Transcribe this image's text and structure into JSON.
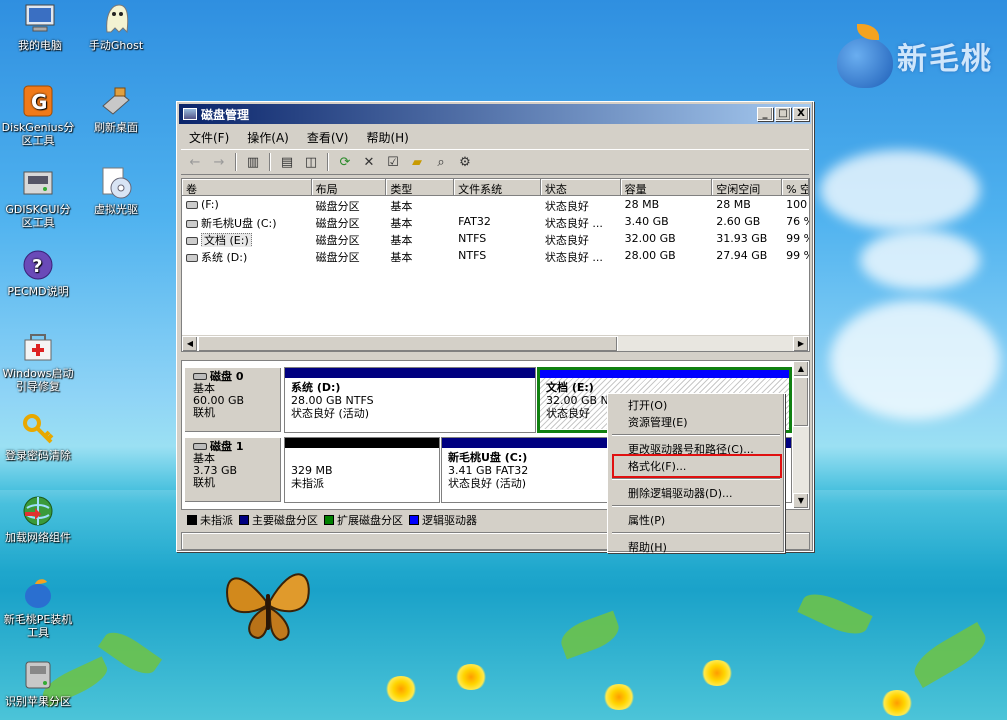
{
  "brand": {
    "name": "新毛桃"
  },
  "desktop_icons": [
    {
      "label": "我的电脑",
      "icon": "computer-icon"
    },
    {
      "label": "手动Ghost",
      "icon": "ghost-icon"
    },
    {
      "label": "DiskGenius分区工具",
      "icon": "diskgenius-icon"
    },
    {
      "label": "刷新桌面",
      "icon": "refresh-desktop-icon"
    },
    {
      "label": "GDISKGUI分区工具",
      "icon": "gdiskgui-icon"
    },
    {
      "label": "虚拟光驱",
      "icon": "virtual-cd-icon"
    },
    {
      "label": "PECMD说明",
      "icon": "help-icon"
    },
    {
      "label": "Windows启动引导修复",
      "icon": "boot-repair-icon"
    },
    {
      "label": "登录密码清除",
      "icon": "key-icon"
    },
    {
      "label": "加载网络组件",
      "icon": "network-icon"
    },
    {
      "label": "新毛桃PE装机工具",
      "icon": "installer-icon"
    },
    {
      "label": "识别苹果分区",
      "icon": "drive-icon"
    }
  ],
  "window": {
    "title": "磁盘管理",
    "controls": {
      "minimize": "_",
      "maximize": "□",
      "close": "X"
    },
    "menu": [
      "文件(F)",
      "操作(A)",
      "查看(V)",
      "帮助(H)"
    ],
    "columns": [
      "卷",
      "布局",
      "类型",
      "文件系统",
      "状态",
      "容量",
      "空闲空间",
      "% 空"
    ],
    "volumes": [
      {
        "name": "(F:)",
        "layout": "磁盘分区",
        "type": "基本",
        "fs": "",
        "status": "状态良好",
        "capacity": "28 MB",
        "free": "28 MB",
        "pct": "100 %"
      },
      {
        "name": "新毛桃U盘 (C:)",
        "layout": "磁盘分区",
        "type": "基本",
        "fs": "FAT32",
        "status": "状态良好 ...",
        "capacity": "3.40 GB",
        "free": "2.60 GB",
        "pct": "76 %"
      },
      {
        "name": "文档 (E:)",
        "layout": "磁盘分区",
        "type": "基本",
        "fs": "NTFS",
        "status": "状态良好",
        "capacity": "32.00 GB",
        "free": "31.93 GB",
        "pct": "99 %"
      },
      {
        "name": "系统 (D:)",
        "layout": "磁盘分区",
        "type": "基本",
        "fs": "NTFS",
        "status": "状态良好 ...",
        "capacity": "28.00 GB",
        "free": "27.94 GB",
        "pct": "99 %"
      }
    ],
    "disks": [
      {
        "name": "磁盘 0",
        "type": "基本",
        "size": "60.00 GB",
        "state": "联机",
        "partitions": [
          {
            "title": "系统 (D:)",
            "line1": "28.00 GB NTFS",
            "line2": "状态良好 (活动)"
          },
          {
            "title": "文档 (E:)",
            "line1": "32.00 GB NTI",
            "line2": "状态良好"
          }
        ]
      },
      {
        "name": "磁盘 1",
        "type": "基本",
        "size": "3.73 GB",
        "state": "联机",
        "partitions": [
          {
            "title": "",
            "line1": "329 MB",
            "line2": "未指派"
          },
          {
            "title": "新毛桃U盘 (C:)",
            "line1": "3.41 GB FAT32",
            "line2": "状态良好 (活动)"
          }
        ]
      }
    ],
    "legend": [
      {
        "label": "未指派",
        "color": "#000000"
      },
      {
        "label": "主要磁盘分区",
        "color": "#000080"
      },
      {
        "label": "扩展磁盘分区",
        "color": "#008000"
      },
      {
        "label": "逻辑驱动器",
        "color": "#0000ff"
      }
    ]
  },
  "context_menu": {
    "items": [
      "打开(O)",
      "资源管理(E)",
      "更改驱动器号和路径(C)...",
      "格式化(F)...",
      "删除逻辑驱动器(D)...",
      "属性(P)",
      "帮助(H)"
    ]
  }
}
